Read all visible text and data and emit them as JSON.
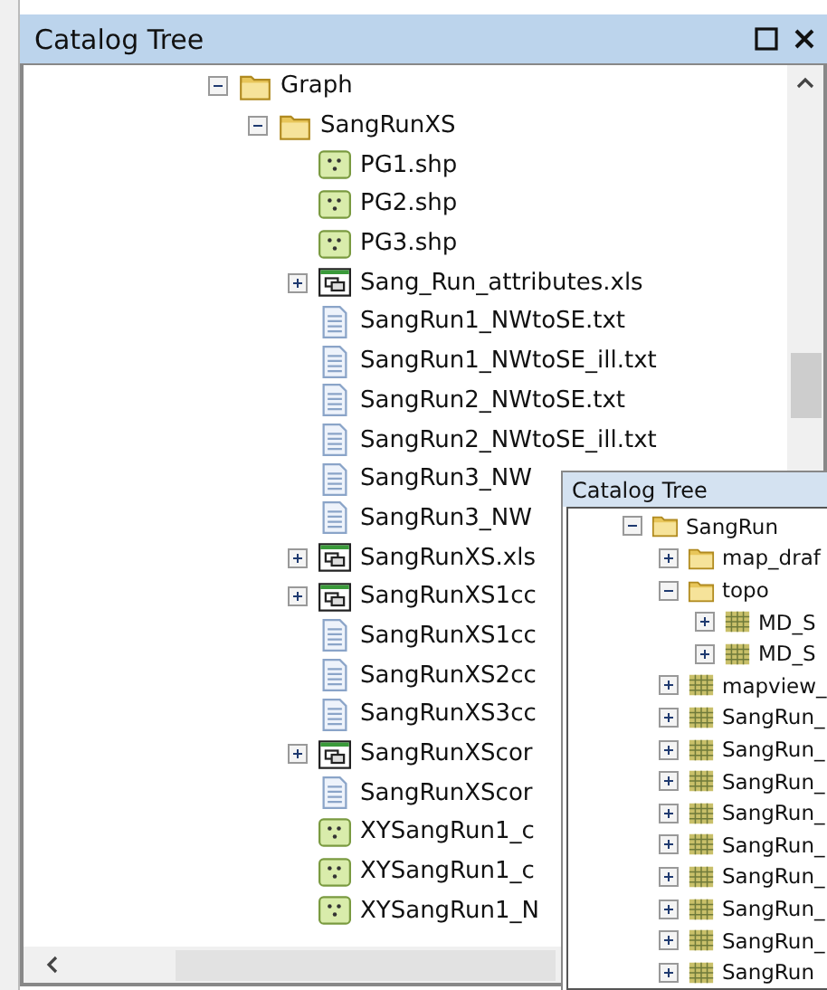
{
  "main_window": {
    "title": "Catalog Tree",
    "tree": [
      {
        "label": "Graph",
        "kind": "folder",
        "expanded": true,
        "children": [
          {
            "label": "SangRunXS",
            "kind": "folder",
            "expanded": true,
            "children": [
              {
                "label": "PG1.shp",
                "kind": "points"
              },
              {
                "label": "PG2.shp",
                "kind": "points"
              },
              {
                "label": "PG3.shp",
                "kind": "points"
              },
              {
                "label": "Sang_Run_attributes.xls",
                "kind": "table",
                "expanded": false
              },
              {
                "label": "SangRun1_NWtoSE.txt",
                "kind": "text"
              },
              {
                "label": "SangRun1_NWtoSE_ill.txt",
                "kind": "text"
              },
              {
                "label": "SangRun2_NWtoSE.txt",
                "kind": "text"
              },
              {
                "label": "SangRun2_NWtoSE_ill.txt",
                "kind": "text"
              },
              {
                "label": "SangRun3_NW",
                "kind": "text"
              },
              {
                "label": "SangRun3_NW",
                "kind": "text"
              },
              {
                "label": "SangRunXS.xls",
                "kind": "table",
                "expanded": false
              },
              {
                "label": "SangRunXS1cc",
                "kind": "table",
                "expanded": false
              },
              {
                "label": "SangRunXS1cc",
                "kind": "text"
              },
              {
                "label": "SangRunXS2cc",
                "kind": "text"
              },
              {
                "label": "SangRunXS3cc",
                "kind": "text"
              },
              {
                "label": "SangRunXScor",
                "kind": "table",
                "expanded": false
              },
              {
                "label": "SangRunXScor",
                "kind": "text"
              },
              {
                "label": "XYSangRun1_c",
                "kind": "points"
              },
              {
                "label": "XYSangRun1_c",
                "kind": "points"
              },
              {
                "label": "XYSangRun1_N",
                "kind": "points"
              }
            ]
          }
        ]
      }
    ]
  },
  "overlay_window": {
    "title": "Catalog Tree",
    "tree": [
      {
        "label": "SangRun",
        "kind": "folder",
        "expanded": true,
        "children": [
          {
            "label": "map_draf",
            "kind": "folder",
            "expanded": false
          },
          {
            "label": "topo",
            "kind": "folder",
            "expanded": true,
            "children": [
              {
                "label": "MD_S",
                "kind": "raster",
                "expanded": false
              },
              {
                "label": "MD_S",
                "kind": "raster",
                "expanded": false
              }
            ]
          },
          {
            "label": "mapview_",
            "kind": "raster",
            "expanded": false
          },
          {
            "label": "SangRun_",
            "kind": "raster",
            "expanded": false
          },
          {
            "label": "SangRun_",
            "kind": "raster",
            "expanded": false
          },
          {
            "label": "SangRun_",
            "kind": "raster",
            "expanded": false
          },
          {
            "label": "SangRun_",
            "kind": "raster",
            "expanded": false
          },
          {
            "label": "SangRun_",
            "kind": "raster",
            "expanded": false
          },
          {
            "label": "SangRun_",
            "kind": "raster",
            "expanded": false
          },
          {
            "label": "SangRun_",
            "kind": "raster",
            "expanded": false
          },
          {
            "label": "SangRun_",
            "kind": "raster",
            "expanded": false
          },
          {
            "label": "SangRun",
            "kind": "raster",
            "expanded": false
          }
        ]
      }
    ]
  }
}
